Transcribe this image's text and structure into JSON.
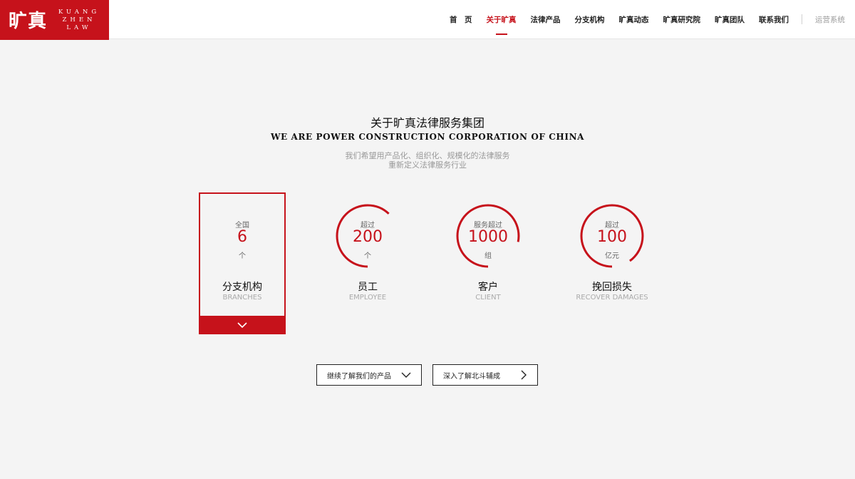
{
  "brand": {
    "logo_cn": "旷真",
    "logo_en": [
      "KUANG",
      "ZHEN",
      "LAW"
    ],
    "color": "#c6121b"
  },
  "nav": {
    "items": [
      {
        "label": "首　页",
        "active": false
      },
      {
        "label": "关于旷真",
        "active": true
      },
      {
        "label": "法律产品",
        "active": false
      },
      {
        "label": "分支机构",
        "active": false
      },
      {
        "label": "旷真动态",
        "active": false
      },
      {
        "label": "旷真研究院",
        "active": false
      },
      {
        "label": "旷真团队",
        "active": false
      },
      {
        "label": "联系我们",
        "active": false
      }
    ],
    "ops_label": "运营系统"
  },
  "intro": {
    "title_cn": "关于旷真法律服务集团",
    "title_en": "WE ARE POWER CONSTRUCTION CORPORATION OF CHINA",
    "subtitle_line1": "我们希望用产品化、组织化、规模化的法律服务",
    "subtitle_line2": "重新定义法律服务行业"
  },
  "stats": [
    {
      "top": "全国",
      "value": "6",
      "unit": "个",
      "label_cn": "分支机构",
      "label_en": "BRANCHES",
      "icon": "chevron-down-icon",
      "ring_fraction": 0
    },
    {
      "top": "超过",
      "value": "200",
      "unit": "个",
      "label_cn": "员工",
      "label_en": "EMPLOYEE",
      "ring_fraction": 0.62
    },
    {
      "top": "服务超过",
      "value": "1000",
      "unit": "组",
      "label_cn": "客户",
      "label_en": "CLIENT",
      "ring_fraction": 0.78
    },
    {
      "top": "超过",
      "value": "100",
      "unit": "亿元",
      "label_cn": "挽回损失",
      "label_en": "RECOVER DAMAGES",
      "ring_fraction": 0.9
    }
  ],
  "buttons": {
    "products": {
      "label": "继续了解我们的产品",
      "icon": "chevron-down-icon"
    },
    "beidou": {
      "label": "深入了解北斗辅成",
      "icon": "chevron-right-icon"
    }
  }
}
